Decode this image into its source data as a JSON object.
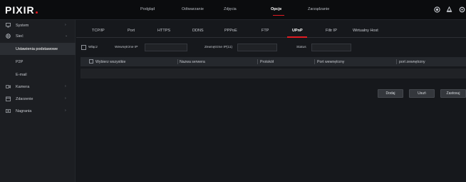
{
  "app": {
    "logo": "PIXIR",
    "accent_color": "#e01b22"
  },
  "top_menu": [
    {
      "label": "Podgląd",
      "active": false
    },
    {
      "label": "Odtwarzanie",
      "active": false
    },
    {
      "label": "Zdjęcia",
      "active": false
    },
    {
      "label": "Opcje",
      "active": true
    },
    {
      "label": "Zarządzanie",
      "active": false
    }
  ],
  "top_icons": [
    "record-icon",
    "alarm-icon",
    "settings-icon"
  ],
  "sidebar": {
    "items": [
      {
        "label": "System",
        "icon": "system-icon"
      },
      {
        "label": "Sieć",
        "icon": "network-icon",
        "expanded": true
      },
      {
        "label": "Kamera",
        "icon": "camera-icon"
      },
      {
        "label": "Zdarzenie",
        "icon": "event-icon"
      },
      {
        "label": "Nagrania",
        "icon": "record-icon"
      }
    ],
    "sub_items": [
      {
        "label": "Ustawienia podstawowe",
        "active": true
      },
      {
        "label": "P2P",
        "active": false
      },
      {
        "label": "E-mail",
        "active": false
      }
    ]
  },
  "tabs": [
    {
      "label": "TCP/IP",
      "active": false
    },
    {
      "label": "Port",
      "active": false
    },
    {
      "label": "HTTPS",
      "active": false
    },
    {
      "label": "DDNS",
      "active": false
    },
    {
      "label": "PPPoE",
      "active": false
    },
    {
      "label": "FTP",
      "active": false
    },
    {
      "label": "UPnP",
      "active": true
    },
    {
      "label": "Filtr IP",
      "active": false
    },
    {
      "label": "Wirtualny Host",
      "active": false
    }
  ],
  "form": {
    "enable_label": "Włącz",
    "enabled": false,
    "internal_ip_label": "Wewnętrzne IP",
    "internal_ip_value": "",
    "external_ip_label": "Zewnętrzne IP(11)",
    "external_ip_value": "",
    "status_label": "Status",
    "status_value": ""
  },
  "table": {
    "select_all_label": "Wybierz wszystkie",
    "columns": [
      "Nazwa serwera",
      "Protokół",
      "Port wewnętrzny",
      "port zewnętrzny"
    ],
    "rows": []
  },
  "buttons": {
    "add": "Dodaj",
    "delete": "Usuń",
    "save": "Zastosuj"
  }
}
